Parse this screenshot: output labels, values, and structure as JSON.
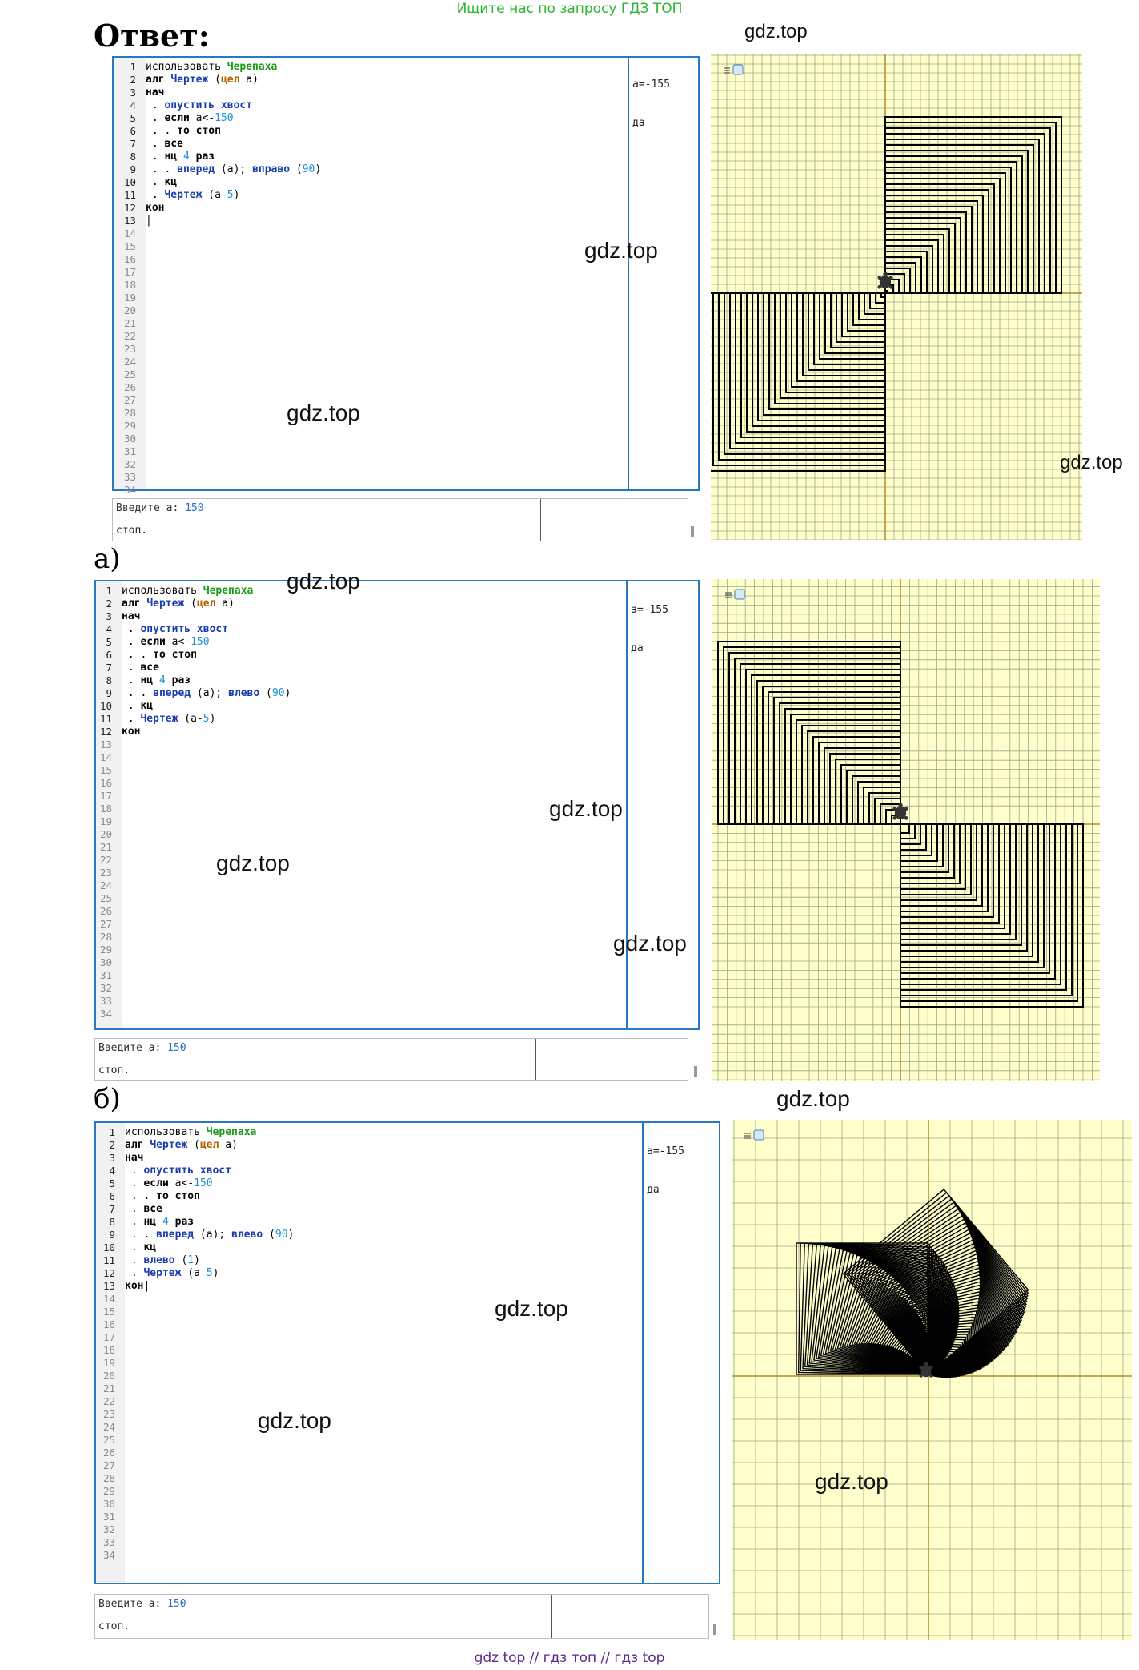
{
  "banner": "Ищите нас по запросу ГДЗ ТОП",
  "answer_title": "Ответ:",
  "labels": {
    "a": "а)",
    "b": "б)"
  },
  "watermarks": {
    "top_right": "gdz.top",
    "p1_editor_right": "gdz.top",
    "p1_editor_left": "gdz.top",
    "p1_canvas": "gdz.top",
    "p2_editor_top": "gdz.top",
    "p2_editor_mid": "gdz.top",
    "p2_editor_left": "gdz.top",
    "p2_editor_low": "gdz.top",
    "p2_under": "gdz.top",
    "p3_editor_right": "gdz.top",
    "p3_editor_left": "gdz.top",
    "p3_canvas": "gdz.top"
  },
  "footer": "gdz top  //  гдз топ  //  гдз top",
  "panels": [
    {
      "line_count": 34,
      "code": [
        [
          {
            "t": "использовать ",
            "c": "tx"
          },
          {
            "t": "Черепаха",
            "c": "lib"
          }
        ],
        [
          {
            "t": "алг ",
            "c": "kw"
          },
          {
            "t": "Чертеж",
            "c": "fn"
          },
          {
            "t": " (",
            "c": "tx"
          },
          {
            "t": "цел",
            "c": "tp"
          },
          {
            "t": " a)",
            "c": "tx"
          }
        ],
        [
          {
            "t": "нач",
            "c": "kw"
          }
        ],
        [
          {
            "t": " . ",
            "c": "tx"
          },
          {
            "t": "опустить хвост",
            "c": "fn"
          }
        ],
        [
          {
            "t": " . ",
            "c": "tx"
          },
          {
            "t": "если",
            "c": "kw"
          },
          {
            "t": " a<-",
            "c": "tx"
          },
          {
            "t": "150",
            "c": "num"
          }
        ],
        [
          {
            "t": " . . ",
            "c": "tx"
          },
          {
            "t": "то стоп",
            "c": "kw"
          }
        ],
        [
          {
            "t": " . ",
            "c": "tx"
          },
          {
            "t": "все",
            "c": "kw"
          }
        ],
        [
          {
            "t": " . ",
            "c": "tx"
          },
          {
            "t": "нц",
            "c": "kw"
          },
          {
            "t": " ",
            "c": "tx"
          },
          {
            "t": "4",
            "c": "num"
          },
          {
            "t": " ",
            "c": "tx"
          },
          {
            "t": "раз",
            "c": "kw"
          }
        ],
        [
          {
            "t": " . . ",
            "c": "tx"
          },
          {
            "t": "вперед",
            "c": "fn"
          },
          {
            "t": " (a); ",
            "c": "tx"
          },
          {
            "t": "вправо",
            "c": "fn"
          },
          {
            "t": " (",
            "c": "tx"
          },
          {
            "t": "90",
            "c": "num"
          },
          {
            "t": ")",
            "c": "tx"
          }
        ],
        [
          {
            "t": " . ",
            "c": "tx"
          },
          {
            "t": "кц",
            "c": "kw"
          }
        ],
        [
          {
            "t": " . ",
            "c": "tx"
          },
          {
            "t": "Чертеж",
            "c": "fn"
          },
          {
            "t": " (a-",
            "c": "tx"
          },
          {
            "t": "5",
            "c": "num"
          },
          {
            "t": ")",
            "c": "tx"
          }
        ],
        [
          {
            "t": "кон",
            "c": "kw"
          }
        ],
        [
          {
            "t": "|",
            "c": "cursor"
          }
        ]
      ],
      "output": [
        {
          "line": 2,
          "text": "a=-155"
        },
        {
          "line": 5,
          "text": "да"
        }
      ],
      "console": {
        "prompt": "Введите a: ",
        "value": "150",
        "status": "стоп."
      }
    },
    {
      "line_count": 34,
      "code": [
        [
          {
            "t": "использовать ",
            "c": "tx"
          },
          {
            "t": "Черепаха",
            "c": "lib"
          }
        ],
        [
          {
            "t": "алг ",
            "c": "kw"
          },
          {
            "t": "Чертеж",
            "c": "fn"
          },
          {
            "t": " (",
            "c": "tx"
          },
          {
            "t": "цел",
            "c": "tp"
          },
          {
            "t": " a)",
            "c": "tx"
          }
        ],
        [
          {
            "t": "нач",
            "c": "kw"
          }
        ],
        [
          {
            "t": " . ",
            "c": "tx"
          },
          {
            "t": "опустить хвост",
            "c": "fn"
          }
        ],
        [
          {
            "t": " . ",
            "c": "tx"
          },
          {
            "t": "если",
            "c": "kw"
          },
          {
            "t": " a<-",
            "c": "tx"
          },
          {
            "t": "150",
            "c": "num"
          }
        ],
        [
          {
            "t": " . . ",
            "c": "tx"
          },
          {
            "t": "то стоп",
            "c": "kw"
          }
        ],
        [
          {
            "t": " . ",
            "c": "tx"
          },
          {
            "t": "все",
            "c": "kw"
          }
        ],
        [
          {
            "t": " . ",
            "c": "tx"
          },
          {
            "t": "нц",
            "c": "kw"
          },
          {
            "t": " ",
            "c": "tx"
          },
          {
            "t": "4",
            "c": "num"
          },
          {
            "t": " ",
            "c": "tx"
          },
          {
            "t": "раз",
            "c": "kw"
          }
        ],
        [
          {
            "t": " . . ",
            "c": "tx"
          },
          {
            "t": "вперед",
            "c": "fn"
          },
          {
            "t": " (a); ",
            "c": "tx"
          },
          {
            "t": "влево",
            "c": "fn"
          },
          {
            "t": " (",
            "c": "tx"
          },
          {
            "t": "90",
            "c": "num"
          },
          {
            "t": ")",
            "c": "tx"
          }
        ],
        [
          {
            "t": " . ",
            "c": "tx"
          },
          {
            "t": "кц",
            "c": "kw"
          }
        ],
        [
          {
            "t": " . ",
            "c": "tx"
          },
          {
            "t": "Чертеж",
            "c": "fn"
          },
          {
            "t": " (a-",
            "c": "tx"
          },
          {
            "t": "5",
            "c": "num"
          },
          {
            "t": ")",
            "c": "tx"
          }
        ],
        [
          {
            "t": "кон",
            "c": "kw"
          }
        ]
      ],
      "output": [
        {
          "line": 2,
          "text": "a=-155"
        },
        {
          "line": 5,
          "text": "да"
        }
      ],
      "console": {
        "prompt": "Введите a: ",
        "value": "150",
        "status": "стоп."
      }
    },
    {
      "line_count": 34,
      "code": [
        [
          {
            "t": "использовать ",
            "c": "tx"
          },
          {
            "t": "Черепаха",
            "c": "lib"
          }
        ],
        [
          {
            "t": "алг ",
            "c": "kw"
          },
          {
            "t": "Чертеж",
            "c": "fn"
          },
          {
            "t": " (",
            "c": "tx"
          },
          {
            "t": "цел",
            "c": "tp"
          },
          {
            "t": " a)",
            "c": "tx"
          }
        ],
        [
          {
            "t": "нач",
            "c": "kw"
          }
        ],
        [
          {
            "t": " . ",
            "c": "tx"
          },
          {
            "t": "опустить хвост",
            "c": "fn"
          }
        ],
        [
          {
            "t": " . ",
            "c": "tx"
          },
          {
            "t": "если",
            "c": "kw"
          },
          {
            "t": " a<-",
            "c": "tx"
          },
          {
            "t": "150",
            "c": "num"
          }
        ],
        [
          {
            "t": " . . ",
            "c": "tx"
          },
          {
            "t": "то стоп",
            "c": "kw"
          }
        ],
        [
          {
            "t": " . ",
            "c": "tx"
          },
          {
            "t": "все",
            "c": "kw"
          }
        ],
        [
          {
            "t": " . ",
            "c": "tx"
          },
          {
            "t": "нц",
            "c": "kw"
          },
          {
            "t": " ",
            "c": "tx"
          },
          {
            "t": "4",
            "c": "num"
          },
          {
            "t": " ",
            "c": "tx"
          },
          {
            "t": "раз",
            "c": "kw"
          }
        ],
        [
          {
            "t": " . . ",
            "c": "tx"
          },
          {
            "t": "вперед",
            "c": "fn"
          },
          {
            "t": " (a); ",
            "c": "tx"
          },
          {
            "t": "влево",
            "c": "fn"
          },
          {
            "t": " (",
            "c": "tx"
          },
          {
            "t": "90",
            "c": "num"
          },
          {
            "t": ")",
            "c": "tx"
          }
        ],
        [
          {
            "t": " . ",
            "c": "tx"
          },
          {
            "t": "кц",
            "c": "kw"
          }
        ],
        [
          {
            "t": " . ",
            "c": "tx"
          },
          {
            "t": "влево",
            "c": "fn"
          },
          {
            "t": " (",
            "c": "tx"
          },
          {
            "t": "1",
            "c": "num"
          },
          {
            "t": ")",
            "c": "tx"
          }
        ],
        [
          {
            "t": " . ",
            "c": "tx"
          },
          {
            "t": "Чертеж",
            "c": "fn"
          },
          {
            "t": " (a ",
            "c": "tx"
          },
          {
            "t": "5",
            "c": "num"
          },
          {
            "t": ")",
            "c": "tx"
          }
        ],
        [
          {
            "t": "кон",
            "c": "kw"
          },
          {
            "t": "|",
            "c": "cursor"
          }
        ]
      ],
      "output": [
        {
          "line": 2,
          "text": "a=-155"
        },
        {
          "line": 5,
          "text": "да"
        }
      ],
      "console": {
        "prompt": "Введите a: ",
        "value": "150",
        "status": "стоп."
      }
    }
  ],
  "colors": {
    "canvas_bg": "#ffffcc",
    "grid": "#9aa88a",
    "axis": "#b08a2a",
    "editor_border": "#2b78c2"
  }
}
